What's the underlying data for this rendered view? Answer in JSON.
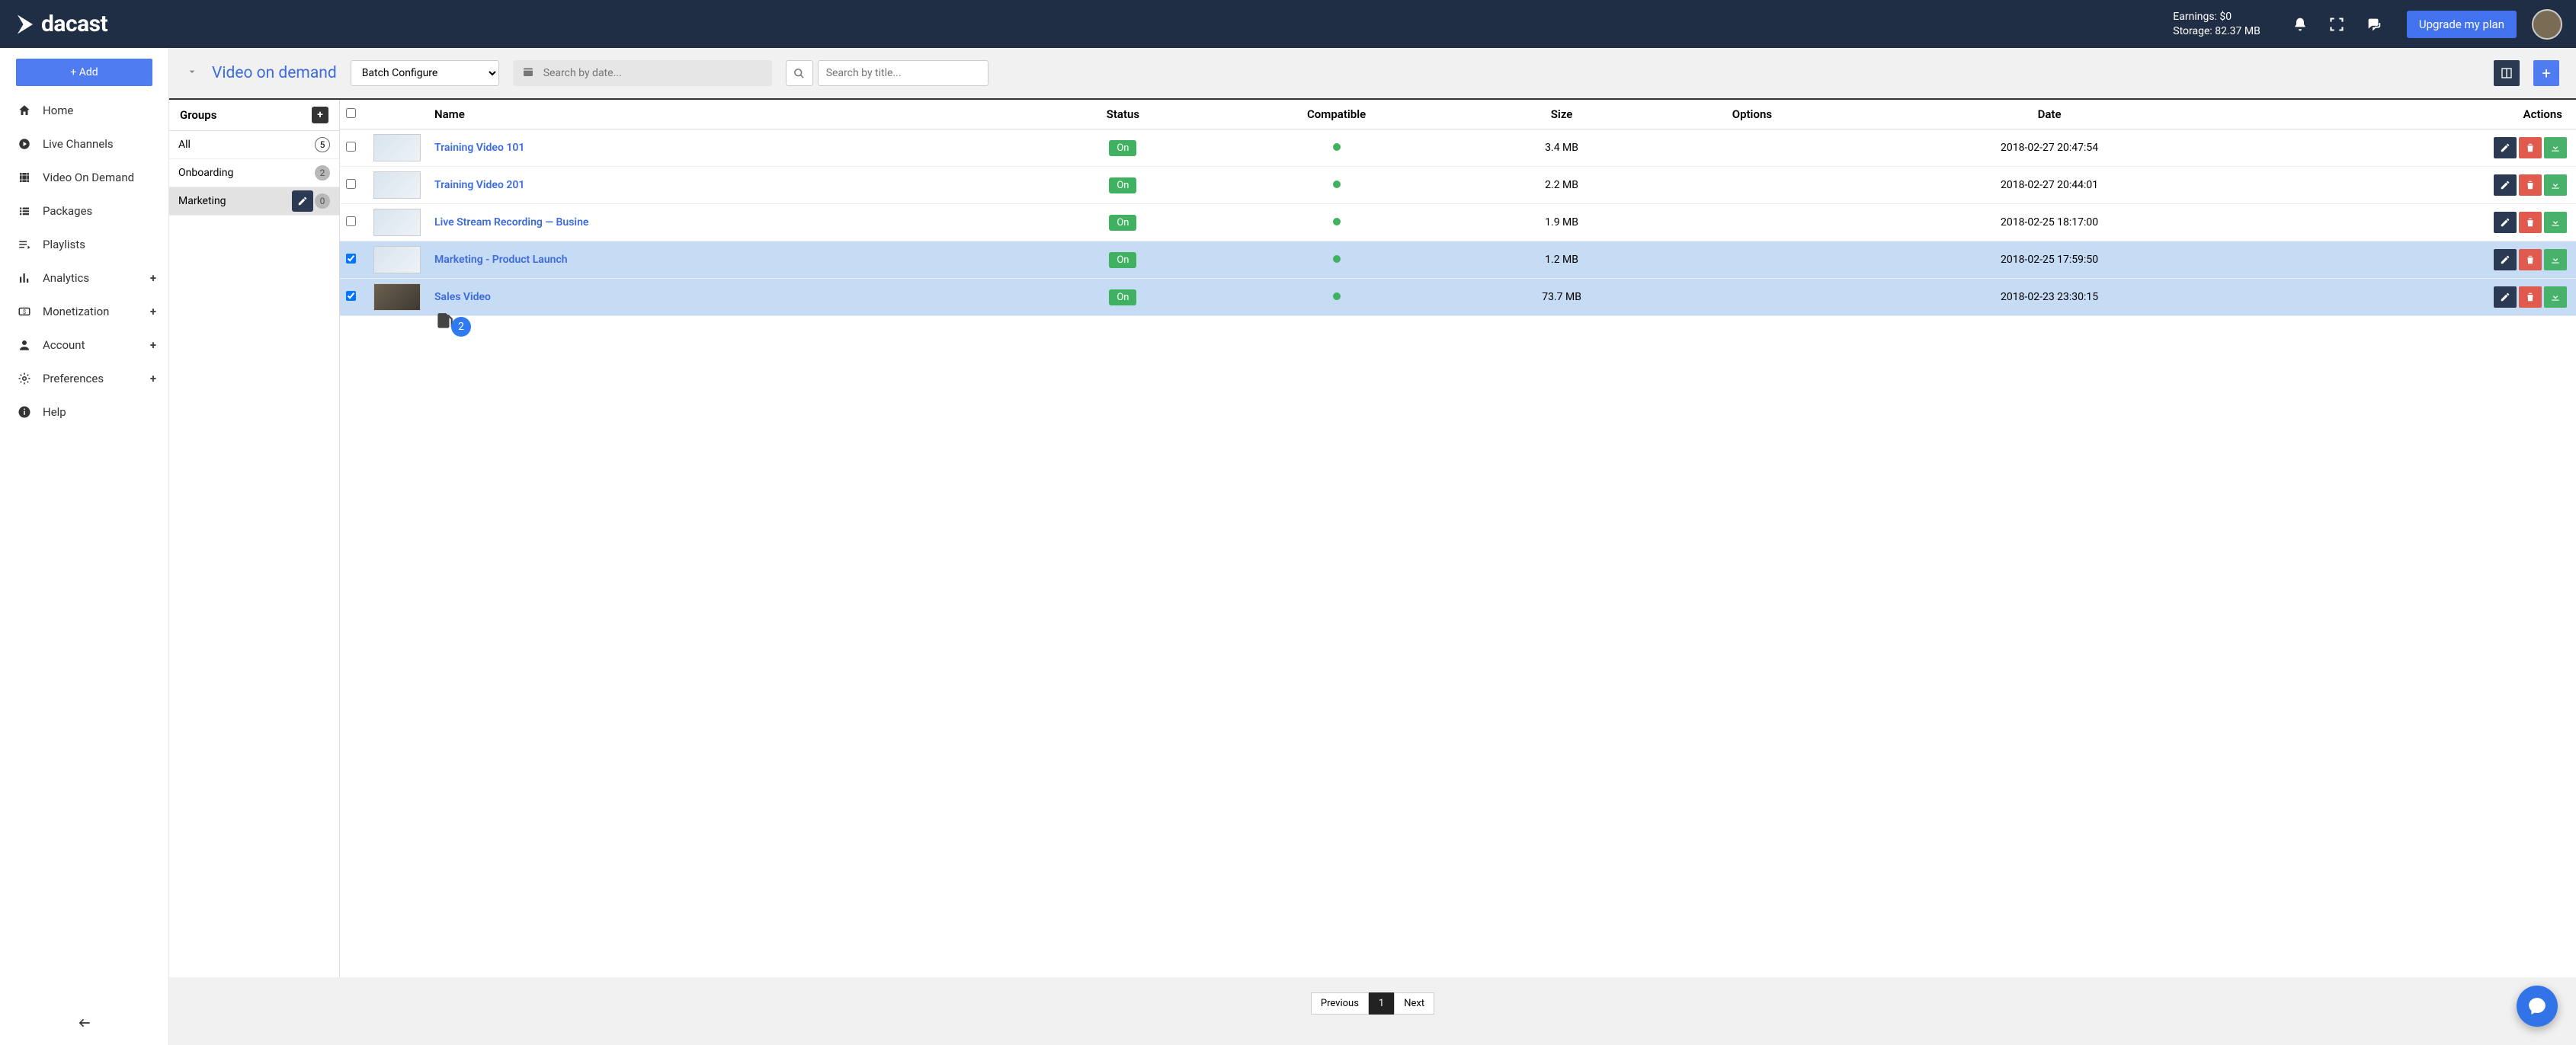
{
  "header": {
    "brand": "dacast",
    "earnings_label": "Earnings: $0",
    "storage_label": "Storage: 82.37 MB",
    "upgrade_label": "Upgrade my plan"
  },
  "sidebar": {
    "add_label": "+ Add",
    "items": [
      {
        "label": "Home",
        "icon": "home"
      },
      {
        "label": "Live Channels",
        "icon": "play-circle"
      },
      {
        "label": "Video On Demand",
        "icon": "film"
      },
      {
        "label": "Packages",
        "icon": "list"
      },
      {
        "label": "Playlists",
        "icon": "playlist"
      },
      {
        "label": "Analytics",
        "icon": "bar-chart",
        "expandable": true
      },
      {
        "label": "Monetization",
        "icon": "dollar",
        "expandable": true
      },
      {
        "label": " Account",
        "icon": "person",
        "expandable": true
      },
      {
        "label": "Preferences",
        "icon": "gear",
        "expandable": true
      },
      {
        "label": "Help",
        "icon": "info"
      }
    ]
  },
  "page": {
    "title": "Video on demand",
    "batch_label": "Batch Configure",
    "search_date_placeholder": "Search by date...",
    "search_title_placeholder": "Search by title..."
  },
  "groups": {
    "header": "Groups",
    "items": [
      {
        "name": "All",
        "count": "5",
        "style": "outline"
      },
      {
        "name": "Onboarding",
        "count": "2",
        "style": "grey"
      },
      {
        "name": "Marketing",
        "count": "0",
        "style": "grey",
        "active": true
      }
    ],
    "drag_count": "2"
  },
  "table": {
    "columns": {
      "name": "Name",
      "status": "Status",
      "compatible": "Compatible",
      "size": "Size",
      "options": "Options",
      "date": "Date",
      "actions": "Actions"
    },
    "rows": [
      {
        "selected": false,
        "name": "Training Video 101",
        "status": "On",
        "size": "3.4 MB",
        "date": "2018-02-27 20:47:54",
        "thumb": "light"
      },
      {
        "selected": false,
        "name": "Training Video 201",
        "status": "On",
        "size": "2.2 MB",
        "date": "2018-02-27 20:44:01",
        "thumb": "light"
      },
      {
        "selected": false,
        "name": "Live Stream Recording — Busine",
        "status": "On",
        "size": "1.9 MB",
        "date": "2018-02-25 18:17:00",
        "thumb": "light"
      },
      {
        "selected": true,
        "name": "Marketing - Product Launch",
        "status": "On",
        "size": "1.2 MB",
        "date": "2018-02-25 17:59:50",
        "thumb": "light"
      },
      {
        "selected": true,
        "name": "Sales Video",
        "status": "On",
        "size": "73.7 MB",
        "date": "2018-02-23 23:30:15",
        "thumb": "dark"
      }
    ]
  },
  "pager": {
    "prev": "Previous",
    "pages": [
      "1"
    ],
    "next": "Next"
  }
}
